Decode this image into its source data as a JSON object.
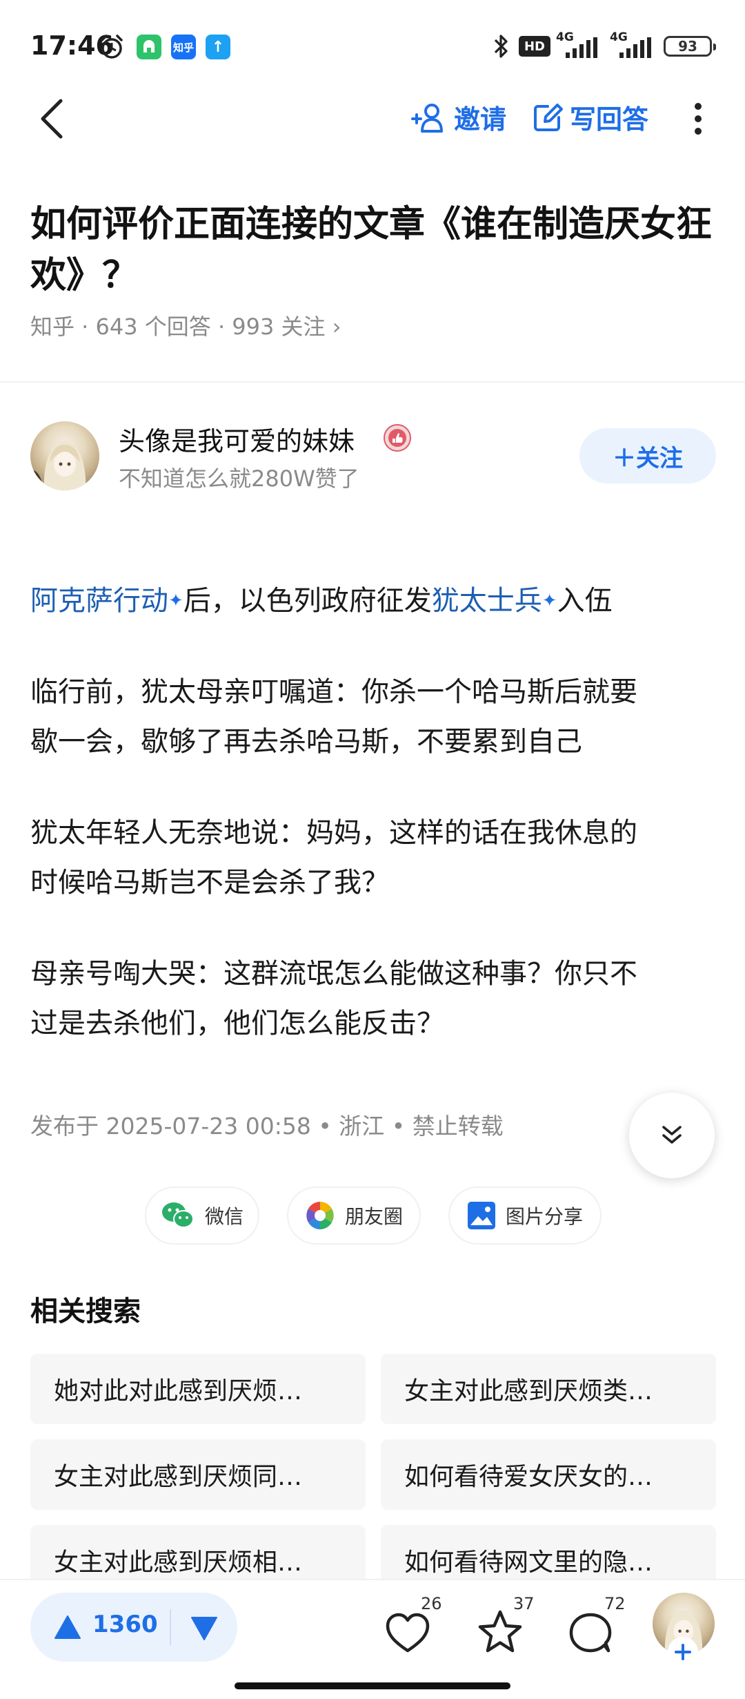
{
  "status_bar": {
    "time": "17:46",
    "apps": [
      {
        "name": "green-app-icon",
        "label": "",
        "color": "#2ec36b"
      },
      {
        "name": "zhihu-app-icon",
        "label": "知乎",
        "color": "#1772f6"
      },
      {
        "name": "upload-app-icon",
        "label": "↑",
        "color": "#1da1f2"
      }
    ],
    "hd_label": "HD",
    "net1": "4G",
    "net2": "4G",
    "battery": "93"
  },
  "nav": {
    "invite_label": "邀请",
    "write_answer_label": "写回答"
  },
  "question": {
    "title": "如何评价正面连接的文章《谁在制造厌女狂欢》？",
    "meta": "知乎 · 643 个回答 · 993 关注 ›"
  },
  "author": {
    "name": "头像是我可爱的妹妹",
    "subtitle": "不知道怎么就280W赞了",
    "follow_label": "＋关注"
  },
  "answer": {
    "p1_link1": "阿克萨行动",
    "p1_text1": "后，以色列政府征发",
    "p1_link2": "犹太士兵",
    "p1_text2": "入伍",
    "p2_line1": "临行前，犹太母亲叮嘱道：你杀一个哈马斯后就要",
    "p2_line2": "歇一会，歇够了再去杀哈马斯，不要累到自己",
    "p3_line1": "犹太年轻人无奈地说：妈妈，这样的话在我休息的",
    "p3_line2": "时候哈马斯岂不是会杀了我？",
    "p4_line1": "母亲号啕大哭：这群流氓怎么能做这种事？你只不",
    "p4_line2": "过是去杀他们，他们怎么能反击？",
    "publish_meta": "发布于 2025-07-23 00:58 • 浙江 • 禁止转载"
  },
  "share": {
    "wechat": "微信",
    "moments": "朋友圈",
    "image_share": "图片分享"
  },
  "related": {
    "title": "相关搜索",
    "items": [
      "她对此对此感到厌烦…",
      "女主对此感到厌烦类…",
      "女主对此感到厌烦同…",
      "如何看待爱女厌女的…",
      "女主对此感到厌烦相…",
      "如何看待网文里的隐…"
    ]
  },
  "bottom": {
    "upvotes": "1360",
    "likes": "26",
    "favorites": "37",
    "comments": "72"
  },
  "colors": {
    "accent": "#1e6ee6",
    "link": "#1d5fb3",
    "pill_bg": "#eaf2fe"
  }
}
